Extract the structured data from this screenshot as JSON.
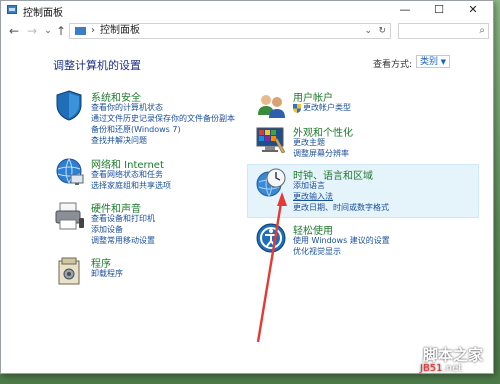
{
  "window": {
    "title": "控制面板",
    "minimize": "—",
    "maximize": "☐",
    "close": "✕"
  },
  "nav": {
    "back": "←",
    "forward": "→",
    "dropdown": "⌄",
    "up": "↑",
    "address_separator": "›",
    "breadcrumb": "控制面板",
    "address_dropdown": "⌄",
    "refresh": "↻",
    "search_icon": "⌕"
  },
  "main": {
    "heading": "调整计算机的设置",
    "view_by_label": "查看方式:",
    "view_by_value": "类别"
  },
  "categories": [
    {
      "title": "系统和安全",
      "icon": "shield-icon",
      "links": [
        "查看你的计算机状态",
        "通过文件历史记录保存你的文件备份副本",
        "备份和还原(Windows 7)",
        "查找并解决问题"
      ]
    },
    {
      "title": "网络和 Internet",
      "icon": "network-icon",
      "links": [
        "查看网络状态和任务",
        "选择家庭组和共享选项"
      ]
    },
    {
      "title": "硬件和声音",
      "icon": "printer-icon",
      "links": [
        "查看设备和打印机",
        "添加设备",
        "调整常用移动设置"
      ]
    },
    {
      "title": "程序",
      "icon": "programs-icon",
      "links": [
        "卸载程序"
      ]
    },
    {
      "title": "用户帐户",
      "icon": "users-icon",
      "links": [
        "更改帐户类型"
      ]
    },
    {
      "title": "外观和个性化",
      "icon": "appearance-icon",
      "links": [
        "更改主题",
        "调整屏幕分辨率"
      ]
    },
    {
      "title": "时钟、语言和区域",
      "icon": "clock-globe-icon",
      "links": [
        "添加语言",
        "更改输入法",
        "更改日期、时间或数字格式"
      ]
    },
    {
      "title": "轻松使用",
      "icon": "ease-of-access-icon",
      "links": [
        "使用 Windows 建议的设置",
        "优化视觉显示"
      ]
    }
  ],
  "watermark": {
    "line1": "脚本之家",
    "line2_part1": "JB51",
    "line2_part2": ".net"
  },
  "colors": {
    "category_title": "#1e7a2e",
    "link": "#1a4f9c",
    "heading": "#1e3287",
    "annotation_arrow": "#e53935"
  }
}
